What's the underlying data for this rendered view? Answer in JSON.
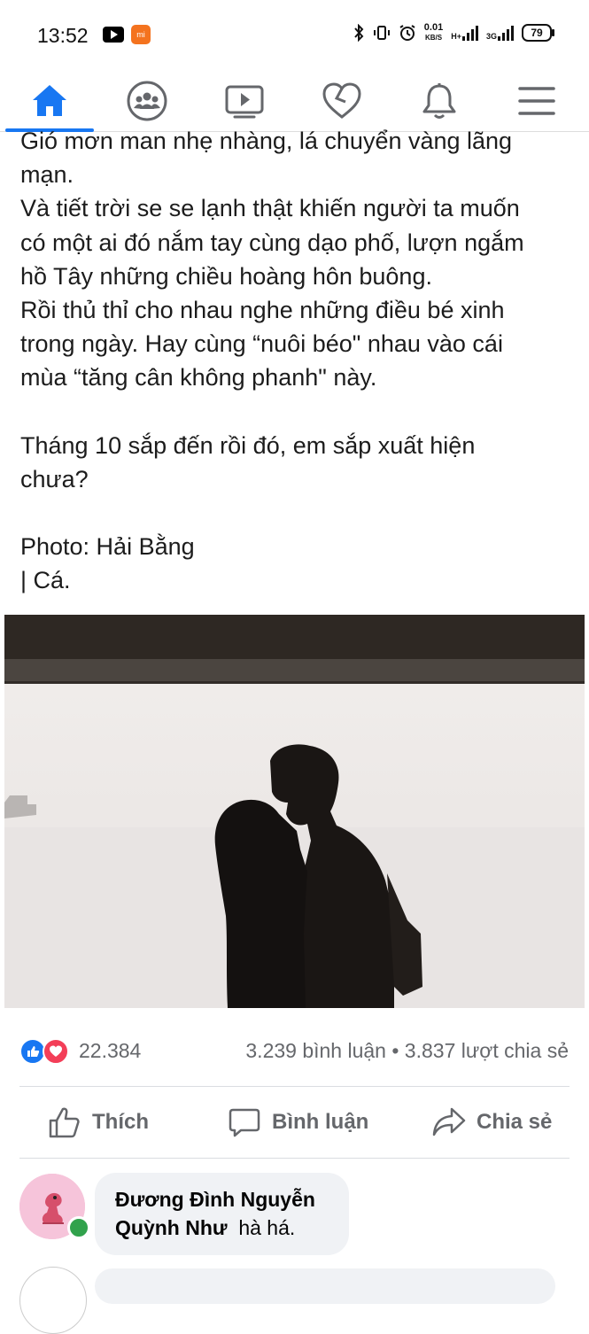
{
  "status_bar": {
    "time": "13:52",
    "net_speed_value": "0.01",
    "net_speed_unit": "KB/S",
    "network_1": "H+",
    "network_2": "3G",
    "battery": "79"
  },
  "nav": {
    "items": [
      "home-icon",
      "groups-icon",
      "watch-icon",
      "dating-icon",
      "notifications-icon",
      "menu-icon"
    ],
    "active": "home-icon",
    "accent": "#1877f2"
  },
  "post": {
    "lines": [
      "Gió mơn man nhẹ nhàng, lá chuyển vàng lãng",
      "mạn.",
      "Và tiết trời se se lạnh thật khiến người ta muốn",
      "có một ai đó nắm tay cùng dạo phố, lượn ngắm",
      "hồ Tây những chiều hoàng hôn buông.",
      "Rồi thủ thỉ cho nhau nghe những điều bé xinh",
      "trong ngày. Hay cùng “nuôi béo\" nhau vào cái",
      "mùa “tăng cân không phanh\" này."
    ],
    "paragraph2": [
      "Tháng 10 sắp đến rồi đó, em sắp xuất hiện",
      "chưa?"
    ],
    "credit_line1": "Photo: Hải Bằng",
    "credit_line2": "| Cá."
  },
  "reactions": {
    "count": "22.384",
    "stats": "3.239 bình luận • 3.837 lượt chia sẻ",
    "like_color": "#1877f2",
    "love_color": "#f33e58"
  },
  "actions": {
    "like": "Thích",
    "comment": "Bình luận",
    "share": "Chia sẻ"
  },
  "comment": {
    "author": "Đương Đình Nguyễn Quỳnh Như",
    "text": "hà há."
  }
}
